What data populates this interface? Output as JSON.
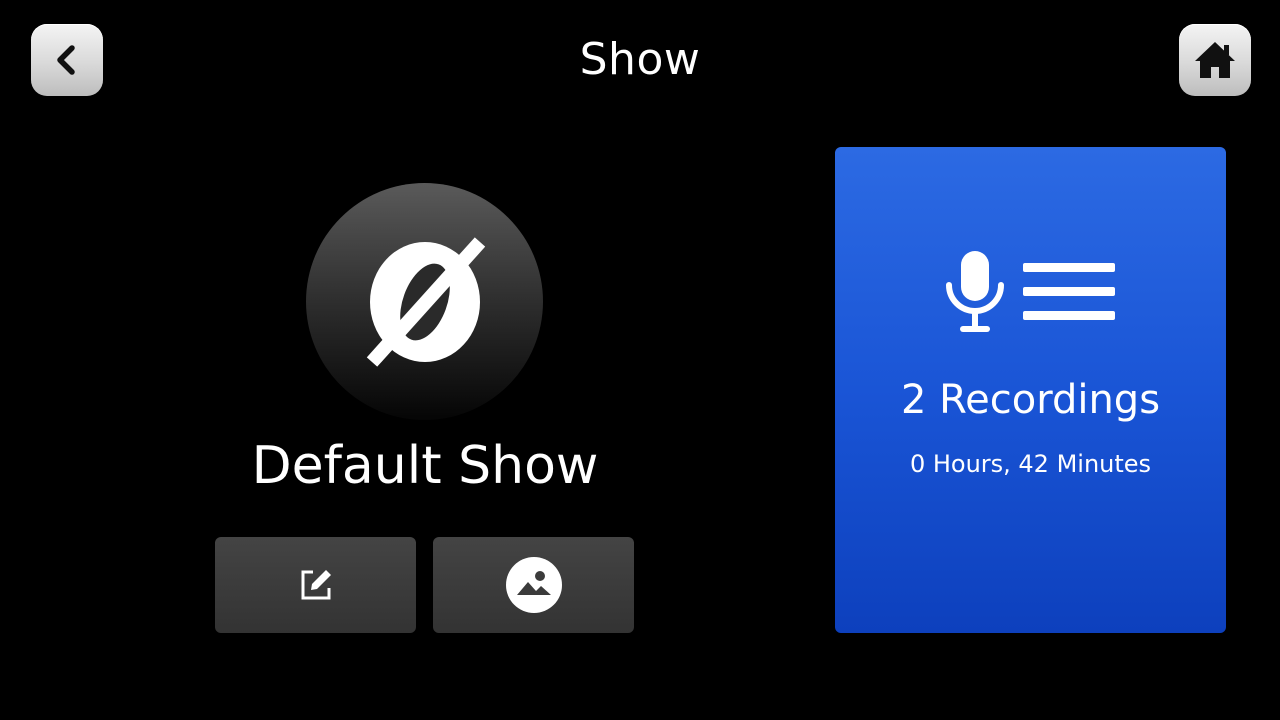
{
  "header": {
    "title": "Show",
    "back_icon": "chevron-left-icon",
    "home_icon": "home-icon"
  },
  "show": {
    "name": "Default Show",
    "logo_glyph": "Ø",
    "logo_icon": "null-symbol-icon"
  },
  "actions": {
    "edit_icon": "edit-icon",
    "image_icon": "image-icon"
  },
  "recordings": {
    "count_label": "2 Recordings",
    "duration_label": "0 Hours, 42 Minutes",
    "icon": "microphone-list-icon"
  },
  "colors": {
    "background": "#000000",
    "card_blue_top": "#2c6ae3",
    "card_blue_bottom": "#0d40bd",
    "button_dark": "#3b3b3b"
  }
}
